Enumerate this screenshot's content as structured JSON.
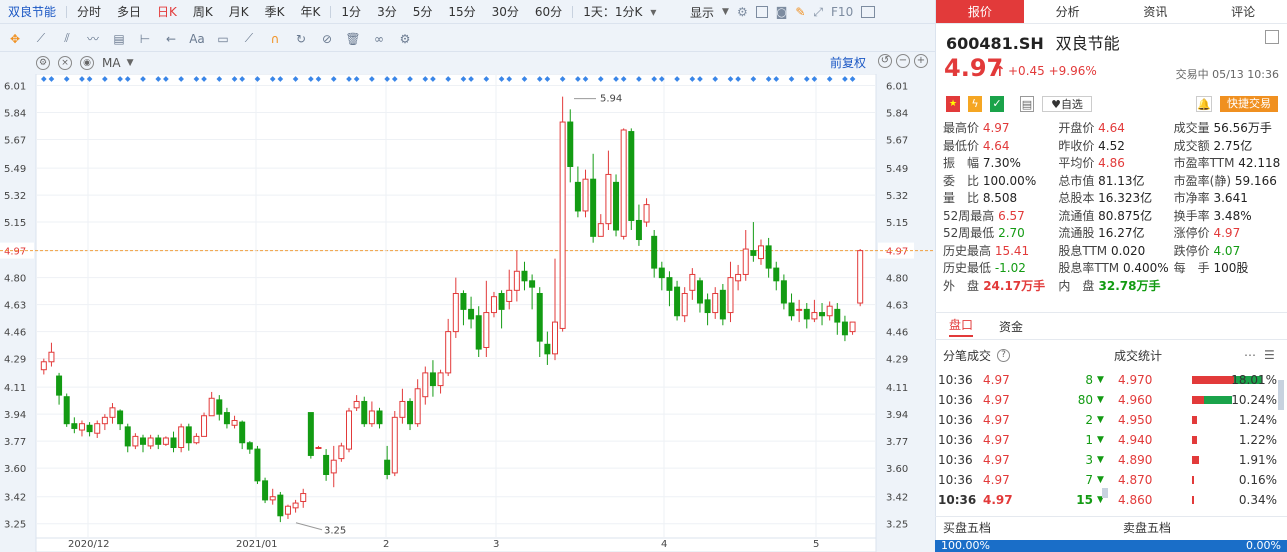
{
  "period_tabs": [
    "双良节能",
    "分时",
    "多日",
    "日K",
    "周K",
    "月K",
    "季K",
    "年K",
    "1分",
    "3分",
    "5分",
    "15分",
    "30分",
    "60分",
    "1天：1分K"
  ],
  "active_period": "日K",
  "display_label": "显示",
  "tools_right": [
    "F10"
  ],
  "ma_label": "MA",
  "adjust_label": "前复权",
  "y_axis": [
    "6.01",
    "5.84",
    "5.67",
    "5.49",
    "5.32",
    "5.15",
    "4.97",
    "4.80",
    "4.63",
    "4.46",
    "4.29",
    "4.11",
    "3.94",
    "3.77",
    "3.60",
    "3.42",
    "3.25"
  ],
  "x_axis": [
    "2020/12",
    "2021/01",
    "2",
    "3",
    "4",
    "5"
  ],
  "current_price_marker": "4.97",
  "high_label": "5.94",
  "low_label": "3.25",
  "colors": {
    "up": "#e23a3a",
    "down": "#139b13",
    "accent": "#1a57c4",
    "tab_active": "#e23a3a"
  },
  "chart_data": {
    "type": "candlestick",
    "ylim": [
      3.16,
      6.07
    ],
    "candles": [
      [
        4.22,
        4.27,
        4.19,
        4.29
      ],
      [
        4.27,
        4.33,
        4.24,
        4.39
      ],
      [
        4.18,
        4.06,
        4.0,
        4.2
      ],
      [
        4.05,
        3.88,
        3.86,
        4.07
      ],
      [
        3.88,
        3.85,
        3.82,
        3.92
      ],
      [
        3.84,
        3.88,
        3.8,
        3.9
      ],
      [
        3.87,
        3.83,
        3.8,
        3.89
      ],
      [
        3.82,
        3.88,
        3.79,
        3.9
      ],
      [
        3.88,
        3.92,
        3.84,
        3.94
      ],
      [
        3.92,
        3.98,
        3.88,
        4.01
      ],
      [
        3.96,
        3.88,
        3.84,
        3.97
      ],
      [
        3.86,
        3.74,
        3.7,
        3.88
      ],
      [
        3.74,
        3.8,
        3.72,
        3.82
      ],
      [
        3.79,
        3.75,
        3.7,
        3.81
      ],
      [
        3.74,
        3.79,
        3.72,
        3.81
      ],
      [
        3.79,
        3.75,
        3.72,
        3.81
      ],
      [
        3.75,
        3.79,
        3.74,
        3.8
      ],
      [
        3.79,
        3.73,
        3.7,
        3.83
      ],
      [
        3.73,
        3.86,
        3.7,
        3.88
      ],
      [
        3.86,
        3.76,
        3.71,
        3.88
      ],
      [
        3.76,
        3.8,
        3.75,
        3.82
      ],
      [
        3.8,
        3.93,
        3.8,
        3.95
      ],
      [
        3.93,
        4.04,
        3.93,
        4.08
      ],
      [
        4.03,
        3.94,
        3.9,
        4.06
      ],
      [
        3.95,
        3.88,
        3.85,
        3.98
      ],
      [
        3.87,
        3.9,
        3.85,
        3.93
      ],
      [
        3.89,
        3.76,
        3.72,
        3.9
      ],
      [
        3.76,
        3.72,
        3.69,
        3.77
      ],
      [
        3.72,
        3.52,
        3.5,
        3.74
      ],
      [
        3.52,
        3.4,
        3.38,
        3.54
      ],
      [
        3.4,
        3.42,
        3.37,
        3.47
      ],
      [
        3.43,
        3.3,
        3.26,
        3.45
      ],
      [
        3.31,
        3.36,
        3.28,
        3.37
      ],
      [
        3.35,
        3.38,
        3.32,
        3.4
      ],
      [
        3.39,
        3.44,
        3.35,
        3.47
      ],
      [
        3.95,
        3.68,
        3.66,
        3.95
      ],
      [
        3.73,
        3.73,
        3.72,
        3.74
      ],
      [
        3.68,
        3.56,
        3.52,
        3.72
      ],
      [
        3.57,
        3.65,
        3.48,
        3.74
      ],
      [
        3.66,
        3.74,
        3.64,
        3.76
      ],
      [
        3.72,
        3.96,
        3.7,
        3.98
      ],
      [
        3.98,
        4.02,
        3.96,
        4.06
      ],
      [
        4.02,
        3.88,
        3.86,
        4.05
      ],
      [
        3.88,
        3.96,
        3.86,
        4.02
      ],
      [
        3.96,
        3.88,
        3.85,
        3.98
      ],
      [
        3.65,
        3.56,
        3.53,
        3.74
      ],
      [
        3.57,
        3.92,
        3.55,
        3.96
      ],
      [
        3.92,
        4.02,
        3.88,
        4.1
      ],
      [
        4.02,
        3.88,
        3.84,
        4.04
      ],
      [
        3.88,
        4.1,
        3.86,
        4.16
      ],
      [
        4.05,
        4.2,
        4.0,
        4.24
      ],
      [
        4.2,
        4.12,
        4.05,
        4.28
      ],
      [
        4.12,
        4.2,
        4.07,
        4.22
      ],
      [
        4.2,
        4.46,
        4.18,
        4.54
      ],
      [
        4.46,
        4.7,
        4.42,
        4.8
      ],
      [
        4.7,
        4.6,
        4.5,
        4.72
      ],
      [
        4.6,
        4.54,
        4.48,
        4.68
      ],
      [
        4.56,
        4.35,
        4.3,
        4.62
      ],
      [
        4.36,
        4.58,
        4.3,
        4.78
      ],
      [
        4.58,
        4.68,
        4.55,
        4.71
      ],
      [
        4.7,
        4.6,
        4.48,
        4.72
      ],
      [
        4.65,
        4.72,
        4.6,
        4.85
      ],
      [
        4.72,
        4.84,
        4.65,
        4.97
      ],
      [
        4.84,
        4.78,
        4.72,
        4.9
      ],
      [
        4.78,
        4.74,
        4.6,
        4.82
      ],
      [
        4.7,
        4.4,
        4.3,
        4.74
      ],
      [
        4.38,
        4.32,
        4.25,
        4.46
      ],
      [
        4.32,
        4.52,
        4.28,
        4.92
      ],
      [
        4.48,
        5.78,
        4.46,
        5.94
      ],
      [
        5.78,
        5.5,
        5.4,
        5.86
      ],
      [
        5.4,
        5.22,
        5.18,
        5.5
      ],
      [
        5.22,
        5.42,
        5.18,
        5.48
      ],
      [
        5.42,
        5.06,
        5.02,
        5.58
      ],
      [
        5.06,
        5.14,
        5.06,
        5.2
      ],
      [
        5.14,
        5.45,
        5.1,
        5.6
      ],
      [
        5.4,
        5.1,
        5.06,
        5.45
      ],
      [
        5.06,
        5.73,
        5.04,
        5.74
      ],
      [
        5.72,
        5.16,
        5.1,
        5.74
      ],
      [
        5.16,
        5.04,
        5.0,
        5.26
      ],
      [
        5.15,
        5.26,
        5.12,
        5.3
      ],
      [
        5.06,
        4.86,
        4.8,
        5.1
      ],
      [
        4.86,
        4.8,
        4.72,
        4.9
      ],
      [
        4.8,
        4.72,
        4.62,
        4.84
      ],
      [
        4.74,
        4.56,
        4.53,
        4.78
      ],
      [
        4.56,
        4.7,
        4.52,
        4.74
      ],
      [
        4.72,
        4.82,
        4.66,
        4.86
      ],
      [
        4.78,
        4.64,
        4.58,
        4.8
      ],
      [
        4.66,
        4.58,
        4.5,
        4.7
      ],
      [
        4.58,
        4.7,
        4.54,
        4.74
      ],
      [
        4.72,
        4.54,
        4.5,
        4.76
      ],
      [
        4.58,
        4.8,
        4.52,
        4.9
      ],
      [
        4.78,
        4.82,
        4.72,
        4.88
      ],
      [
        4.82,
        4.98,
        4.78,
        5.1
      ],
      [
        4.97,
        4.94,
        4.9,
        5.15
      ],
      [
        4.92,
        5.0,
        4.88,
        5.04
      ],
      [
        5.0,
        4.86,
        4.8,
        5.05
      ],
      [
        4.86,
        4.78,
        4.72,
        4.9
      ],
      [
        4.78,
        4.64,
        4.6,
        4.82
      ],
      [
        4.64,
        4.56,
        4.53,
        4.7
      ],
      [
        4.6,
        4.6,
        4.52,
        4.66
      ],
      [
        4.6,
        4.54,
        4.48,
        4.64
      ],
      [
        4.54,
        4.58,
        4.52,
        4.66
      ],
      [
        4.58,
        4.56,
        4.5,
        4.64
      ],
      [
        4.56,
        4.62,
        4.53,
        4.65
      ],
      [
        4.6,
        4.52,
        4.44,
        4.64
      ],
      [
        4.52,
        4.44,
        4.4,
        4.56
      ],
      [
        4.46,
        4.52,
        4.44,
        4.52
      ],
      [
        4.64,
        4.97,
        4.62,
        4.98
      ]
    ]
  },
  "right": {
    "tabs": [
      "报价",
      "分析",
      "资讯",
      "评论"
    ],
    "code": "600481.SH",
    "name": "双良节能",
    "price": "4.97",
    "arrow": "↑",
    "change": "+0.45  +9.96%",
    "trade_status": "交易中 05/13 10:36",
    "tag_zixuan": "自选",
    "tag_fast": "快捷交易",
    "fields": [
      [
        {
          "l": "最高价",
          "v": "4.97",
          "c": "red"
        },
        {
          "l": "开盘价",
          "v": "4.64",
          "c": "red"
        },
        {
          "l": "成交量",
          "v": "56.56万手",
          "c": "dark"
        }
      ],
      [
        {
          "l": "最低价",
          "v": "4.64",
          "c": "red"
        },
        {
          "l": "昨收价",
          "v": "4.52",
          "c": "dark"
        },
        {
          "l": "成交额",
          "v": "2.75亿",
          "c": "dark"
        }
      ],
      [
        {
          "l": "振　幅",
          "v": "7.30%",
          "c": "dark"
        },
        {
          "l": "平均价",
          "v": "4.86",
          "c": "red"
        },
        {
          "l": "市盈率TTM",
          "v": "42.118",
          "c": "dark"
        }
      ],
      [
        {
          "l": "委　比",
          "v": "100.00%",
          "c": "dark"
        },
        {
          "l": "总市值",
          "v": "81.13亿",
          "c": "dark"
        },
        {
          "l": "市盈率(静)",
          "v": "59.166",
          "c": "dark"
        }
      ],
      [
        {
          "l": "量　比",
          "v": "8.508",
          "c": "dark"
        },
        {
          "l": "总股本",
          "v": "16.323亿",
          "c": "dark"
        },
        {
          "l": "市净率",
          "v": "3.641",
          "c": "dark"
        }
      ],
      [
        {
          "l": "52周最高",
          "v": "6.57",
          "c": "red"
        },
        {
          "l": "流通值",
          "v": "80.875亿",
          "c": "dark"
        },
        {
          "l": "换手率",
          "v": "3.48%",
          "c": "dark"
        }
      ],
      [
        {
          "l": "52周最低",
          "v": "2.70",
          "c": "green"
        },
        {
          "l": "流通股",
          "v": "16.27亿",
          "c": "dark"
        },
        {
          "l": "涨停价",
          "v": "4.97",
          "c": "red"
        }
      ],
      [
        {
          "l": "历史最高",
          "v": "15.41",
          "c": "red"
        },
        {
          "l": "股息TTM",
          "v": "0.020",
          "c": "dark"
        },
        {
          "l": "跌停价",
          "v": "4.07",
          "c": "green"
        }
      ],
      [
        {
          "l": "历史最低",
          "v": "-1.02",
          "c": "green"
        },
        {
          "l": "股息率TTM",
          "v": "0.400%",
          "c": "dark"
        },
        {
          "l": "每　手",
          "v": "100股",
          "c": "dark"
        }
      ],
      [
        {
          "l": "外　盘",
          "v": "24.17万手",
          "c": "red"
        },
        {
          "l": "内　盘",
          "v": "32.78万手",
          "c": "green"
        },
        {
          "l": "",
          "v": "",
          "c": "dark"
        }
      ]
    ],
    "section_tabs": [
      "盘口",
      "资金"
    ],
    "sub_left": "分笔成交",
    "sub_right": "成交统计",
    "trades": [
      {
        "t": "10:36",
        "p": "4.97",
        "v": "8",
        "a": "▼"
      },
      {
        "t": "10:36",
        "p": "4.97",
        "v": "80",
        "a": "▼"
      },
      {
        "t": "10:36",
        "p": "4.97",
        "v": "2",
        "a": "▼"
      },
      {
        "t": "10:36",
        "p": "4.97",
        "v": "1",
        "a": "▼"
      },
      {
        "t": "10:36",
        "p": "4.97",
        "v": "3",
        "a": "▼"
      },
      {
        "t": "10:36",
        "p": "4.97",
        "v": "7",
        "a": "▼"
      },
      {
        "t": "10:36",
        "p": "4.97",
        "v": "15",
        "a": "▼"
      }
    ],
    "stats": [
      {
        "p": "4.970",
        "pct": "18.01%",
        "r": 0.6,
        "g": 0.4
      },
      {
        "p": "4.960",
        "pct": "10.24%",
        "r": 0.3,
        "g": 0.7
      },
      {
        "p": "4.950",
        "pct": "1.24%",
        "r": 1,
        "g": 0
      },
      {
        "p": "4.940",
        "pct": "1.22%",
        "r": 1,
        "g": 0
      },
      {
        "p": "4.890",
        "pct": "1.91%",
        "r": 1,
        "g": 0
      },
      {
        "p": "4.870",
        "pct": "0.16%",
        "r": 1,
        "g": 0
      },
      {
        "p": "4.860",
        "pct": "0.34%",
        "r": 1,
        "g": 0
      }
    ],
    "book_left": "买盘五档",
    "book_right": "卖盘五档",
    "bar_left": "100.00%",
    "bar_right": "0.00%"
  }
}
